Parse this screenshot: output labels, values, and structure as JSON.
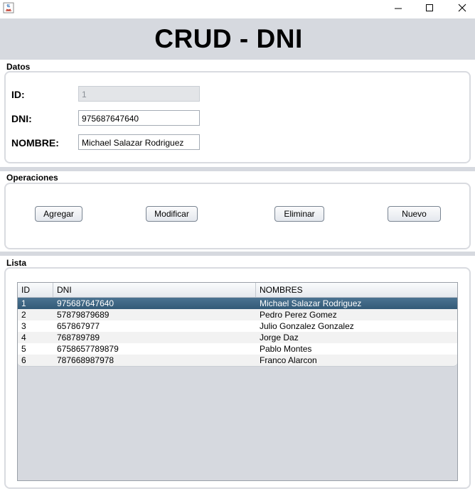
{
  "header": {
    "title": "CRUD - DNI"
  },
  "datos": {
    "section_label": "Datos",
    "id_label": "ID:",
    "id_value": "1",
    "dni_label": "DNI:",
    "dni_value": "975687647640",
    "nombre_label": "NOMBRE:",
    "nombre_value": "Michael Salazar Rodriguez"
  },
  "operaciones": {
    "section_label": "Operaciones",
    "agregar": "Agregar",
    "modificar": "Modificar",
    "eliminar": "Eliminar",
    "nuevo": "Nuevo"
  },
  "lista": {
    "section_label": "Lista",
    "columns": [
      "ID",
      "DNI",
      "NOMBRES"
    ],
    "rows": [
      [
        "1",
        "975687647640",
        "Michael Salazar Rodriguez"
      ],
      [
        "2",
        "57879879689",
        "Pedro Perez Gomez"
      ],
      [
        "3",
        "657867977",
        "Julio Gonzalez Gonzalez"
      ],
      [
        "4",
        "768789789",
        "Jorge Daz"
      ],
      [
        "5",
        "6758657789879",
        "Pablo Montes"
      ],
      [
        "6",
        "787668987978",
        "Franco Alarcon"
      ]
    ],
    "selected_row": 0
  }
}
